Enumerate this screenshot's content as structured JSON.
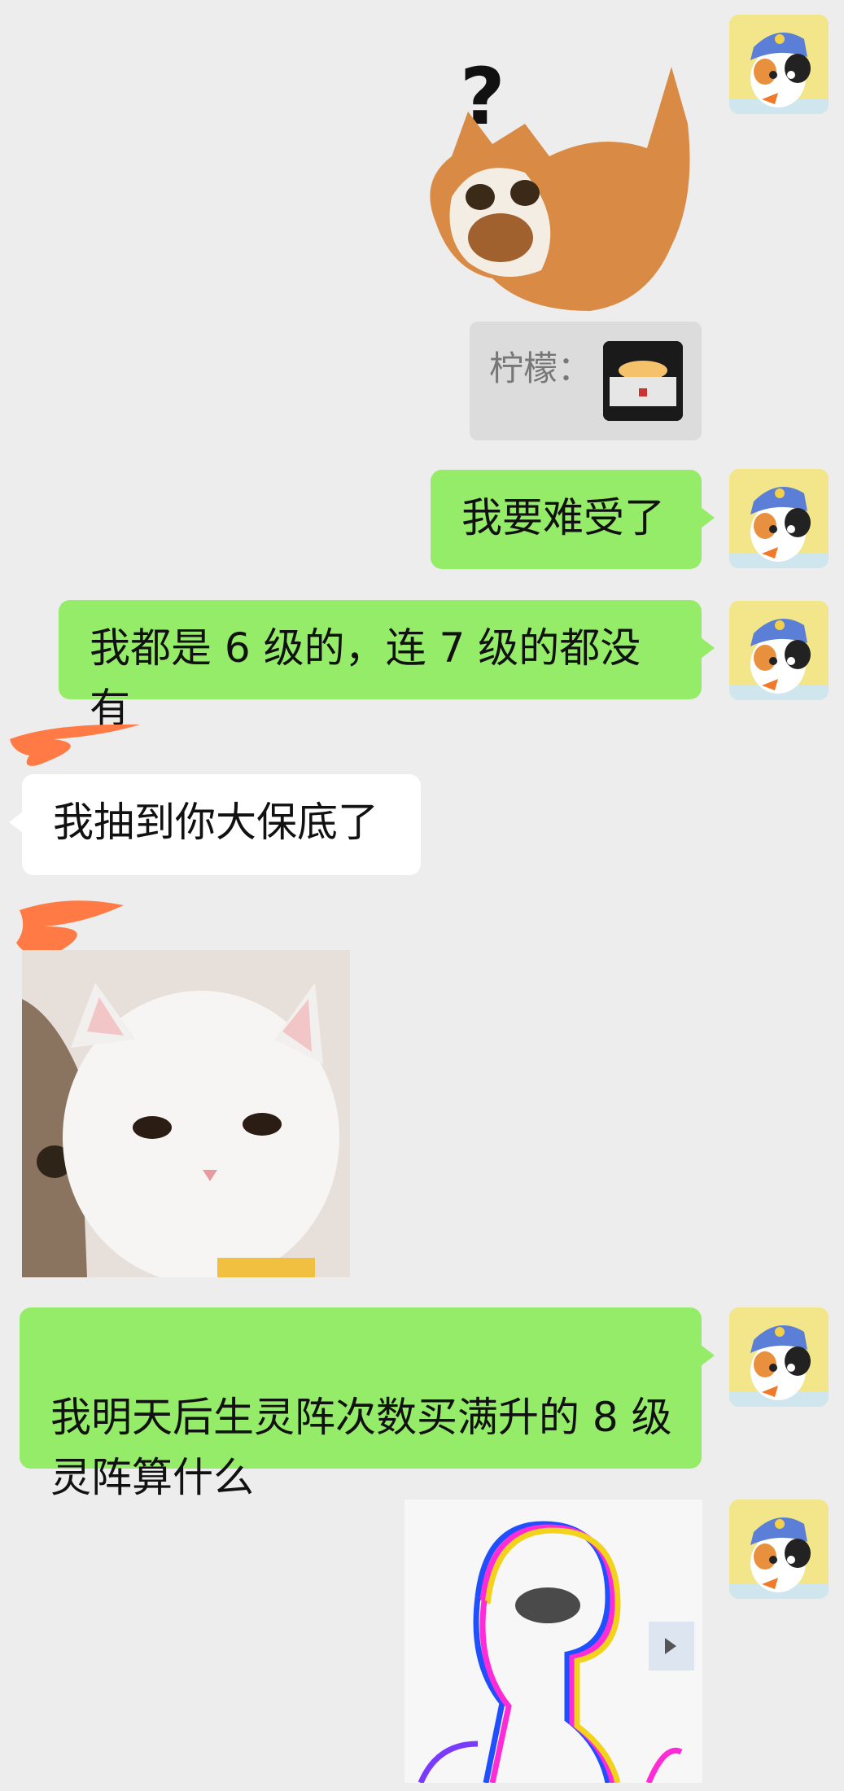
{
  "chat": {
    "messages": [
      {
        "type": "sticker",
        "side": "right",
        "sticker": "question-cat-sticker",
        "caption": "?"
      },
      {
        "type": "quote",
        "side": "right",
        "label": "柠檬：",
        "thumbnail": "stage-image-thumbnail"
      },
      {
        "type": "text",
        "side": "right",
        "text": "我要难受了"
      },
      {
        "type": "text",
        "side": "right",
        "text": "我都是 6 级的，连 7 级的都没有"
      },
      {
        "type": "text",
        "side": "left",
        "text": "我抽到你大保底了",
        "sender_name": "redacted"
      },
      {
        "type": "image",
        "side": "left",
        "image": "white-cat-photo",
        "sender_name": "redacted"
      },
      {
        "type": "text",
        "side": "right",
        "text": "我明天后生灵阵次数买满升的 8 级\n灵阵算什么"
      },
      {
        "type": "sticker",
        "side": "right",
        "sticker": "glitch-meme-sticker"
      }
    ]
  },
  "colors": {
    "background": "#ededed",
    "sent_bubble": "#95ec69",
    "received_bubble": "#ffffff",
    "redaction": "#ff7a45"
  },
  "icons": {
    "self_avatar": "calico-cat-avatar"
  }
}
